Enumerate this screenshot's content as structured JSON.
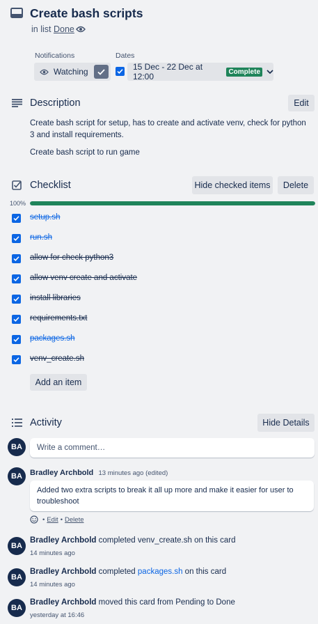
{
  "card": {
    "title": "Create bash scripts",
    "in_list_prefix": "in list",
    "list_name": "Done"
  },
  "notifications": {
    "label": "Notifications",
    "watching_label": "Watching"
  },
  "dates": {
    "label": "Dates",
    "range": "15 Dec - 22 Dec at 12:00",
    "status_badge": "Complete",
    "status_color": "#1f845a"
  },
  "description": {
    "heading": "Description",
    "edit_label": "Edit",
    "paragraph_1": "Create bash script for setup, has to create and activate venv, check for python 3 and install requirements.",
    "paragraph_2": "Create bash script to run game"
  },
  "checklist": {
    "heading": "Checklist",
    "hide_checked_label": "Hide checked items",
    "delete_label": "Delete",
    "progress_text": "100%",
    "progress_fraction": 1.0,
    "progress_color": "#1f845a",
    "items": [
      {
        "label": "setup.sh",
        "checked": true,
        "is_link": true
      },
      {
        "label": "run.sh",
        "checked": true,
        "is_link": true
      },
      {
        "label": "allow for check python3",
        "checked": true,
        "is_link": false
      },
      {
        "label": "allow venv create and activate",
        "checked": true,
        "is_link": false
      },
      {
        "label": "install libraries",
        "checked": true,
        "is_link": false
      },
      {
        "label": "requirements.txt",
        "checked": true,
        "is_link": false
      },
      {
        "label": "packages.sh",
        "checked": true,
        "is_link": true
      },
      {
        "label": "venv_create.sh",
        "checked": true,
        "is_link": false
      }
    ],
    "add_item_label": "Add an item"
  },
  "activity": {
    "heading": "Activity",
    "hide_details_label": "Hide Details",
    "comment_placeholder": "Write a comment…",
    "avatar_initials": "BA",
    "comment": {
      "author": "Bradley Archbold",
      "time": "13 minutes ago (edited)",
      "text": "Added two extra scripts to break it all up more and make it easier for user to troubleshoot",
      "edit_label": "Edit",
      "delete_label": "Delete",
      "separator": "•"
    },
    "events": [
      {
        "author": "Bradley Archbold",
        "pre": "completed",
        "link": "",
        "plain": "venv_create.sh",
        "post": "on this card",
        "time": "14 minutes ago"
      },
      {
        "author": "Bradley Archbold",
        "pre": "completed",
        "link": "packages.sh",
        "plain": "",
        "post": "on this card",
        "time": "14 minutes ago"
      },
      {
        "author": "Bradley Archbold",
        "pre": "moved this card from Pending to Done",
        "link": "",
        "plain": "",
        "post": "",
        "time": "yesterday at 16:46"
      }
    ]
  }
}
